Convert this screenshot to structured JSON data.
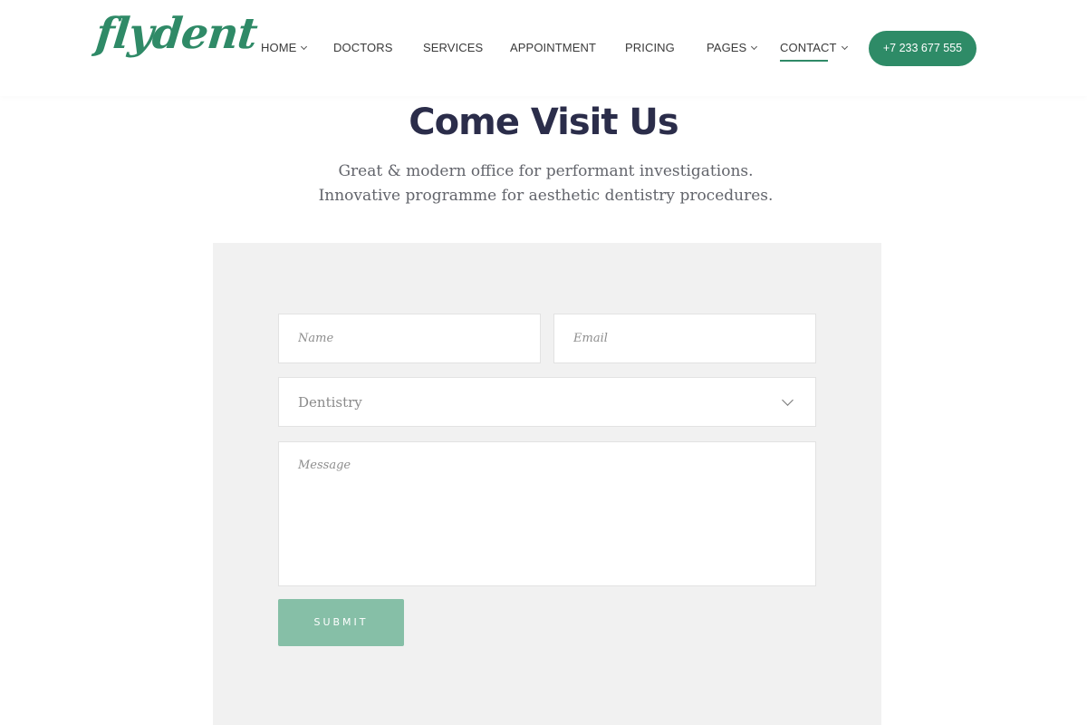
{
  "brand": {
    "logo_text": "flydent",
    "accent_color": "#2e8b67"
  },
  "nav": {
    "items": [
      {
        "label": "HOME",
        "has_dropdown": true
      },
      {
        "label": "DOCTORS",
        "has_dropdown": false
      },
      {
        "label": "SERVICES",
        "has_dropdown": false
      },
      {
        "label": "APPOINTMENT",
        "has_dropdown": false
      },
      {
        "label": "PRICING",
        "has_dropdown": false
      },
      {
        "label": "PAGES",
        "has_dropdown": true
      },
      {
        "label": "CONTACT",
        "has_dropdown": true,
        "active": true
      }
    ],
    "phone_button": "+7 233 677 555"
  },
  "hero": {
    "title": "Come Visit Us",
    "subtitle": "Great & modern office for performant investigations. Innovative programme for aesthetic dentistry procedures."
  },
  "form": {
    "name_placeholder": "Name",
    "email_placeholder": "Email",
    "department_selected": "Dentistry",
    "message_placeholder": "Message",
    "submit_label": "SUBMIT",
    "submit_color": "#86bfa7",
    "panel_color": "#f1f1f1"
  }
}
